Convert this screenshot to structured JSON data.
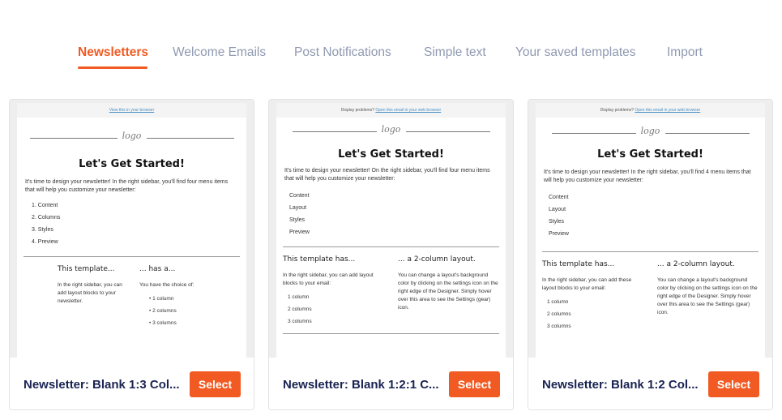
{
  "tabs": [
    {
      "label": "Newsletters",
      "active": true
    },
    {
      "label": "Welcome Emails"
    },
    {
      "label": "Post Notifications"
    },
    {
      "label": "Simple text"
    },
    {
      "label": "Your saved templates"
    },
    {
      "label": "Import"
    }
  ],
  "accent_color": "#f15a22",
  "templates": [
    {
      "title": "Newsletter: Blank 1:3 Col...",
      "select_label": "Select",
      "preheader_link": "View this in your browser",
      "logo": "logo",
      "heading": "Let's Get Started!",
      "intro": "It's time to design your newsletter! In the right sidebar, you'll find four menu items that will help you customize your newsletter:",
      "items": [
        "1.  Content",
        "2.  Columns",
        "3.  Styles",
        "4.  Preview"
      ],
      "col1_title": "This template...",
      "col1_text": "In the right sidebar, you can add layout blocks to your newsletter.",
      "col2_title": "... has a...",
      "col2_text": "You have the choice of:",
      "col2_items": [
        "•  1 column",
        "•  2 columns",
        "•  3 columns"
      ]
    },
    {
      "title": "Newsletter: Blank 1:2:1 C...",
      "select_label": "Select",
      "preheader_text": "Display problems? ",
      "preheader_link": "Open this email in your web browser",
      "logo": "logo",
      "heading": "Let's Get Started!",
      "intro": "It's time to design your newsletter! On the right sidebar, you'll find four menu items that will help you customize your newsletter:",
      "items": [
        "Content",
        "Layout",
        "Styles",
        "Preview"
      ],
      "col1_title": "This template has...",
      "col1_text": "In the right sidebar, you can add layout blocks to your email:",
      "col1_items": [
        "1 column",
        "2 columns",
        "3 columns"
      ],
      "col2_title": "... a 2-column layout.",
      "col2_text": "You can change a layout's background color by clicking on the settings icon on the right edge of the Designer. Simply hover over this area to see the Settings (gear) icon."
    },
    {
      "title": "Newsletter: Blank 1:2 Col...",
      "select_label": "Select",
      "preheader_text": "Display problems? ",
      "preheader_link": "Open this email in your web browser",
      "logo": "logo",
      "heading": "Let's Get Started!",
      "intro": "It's time to design your newsletter! In the right sidebar, you'll find 4 menu items that will help you customize your newsletter:",
      "items": [
        "Content",
        "Layout",
        "Styles",
        "Preview"
      ],
      "col1_title": "This template has...",
      "col1_text": "In the right sidebar, you can add these layout blocks to your email:",
      "col1_items": [
        "1 column",
        "2 columns",
        "3 columns"
      ],
      "col2_title": "... a 2-column layout.",
      "col2_text": "You can change a layout's background color by clicking on the settings icon on the right edge of the Designer. Simply hover over this area to see the Settings (gear) icon."
    }
  ]
}
